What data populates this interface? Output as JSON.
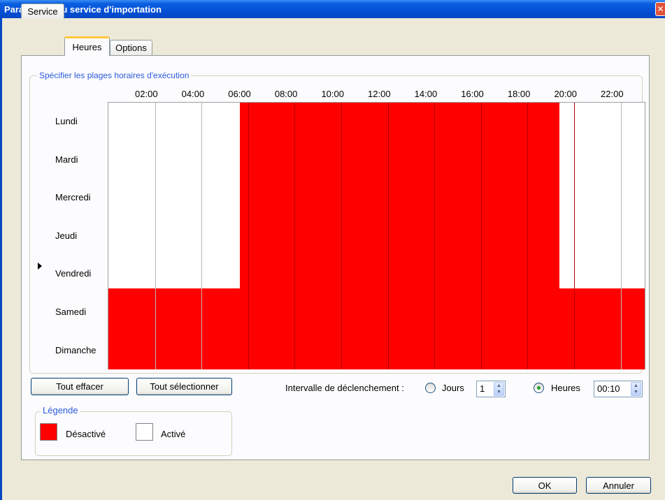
{
  "window": {
    "title": "Paramètres du service d'importation",
    "close_glyph": "✕"
  },
  "tabs": [
    {
      "label": "Service",
      "active": false
    },
    {
      "label": "Heures",
      "active": true
    },
    {
      "label": "Options",
      "active": false
    }
  ],
  "schedule": {
    "group_label": "Spécifier les plages horaires d'exécution",
    "time_labels": [
      "02:00",
      "04:00",
      "06:00",
      "08:00",
      "10:00",
      "12:00",
      "14:00",
      "16:00",
      "18:00",
      "20:00",
      "22:00"
    ],
    "days": [
      "Lundi",
      "Mardi",
      "Mercredi",
      "Jeudi",
      "Vendredi",
      "Samedi",
      "Dimanche"
    ],
    "current_row": "Vendredi",
    "disabled_weekdays_hours": "06:00-20:00",
    "disabled_weekend_hours": "00:00-24:00",
    "colors": {
      "disabled": "#ff0000",
      "enabled": "#ffffff"
    }
  },
  "buttons": {
    "clear_all": "Tout effacer",
    "select_all": "Tout sélectionner",
    "ok": "OK",
    "cancel": "Annuler"
  },
  "interval": {
    "label": "Intervalle de déclenchement :",
    "days_option": "Jours",
    "days_value": "1",
    "hours_option": "Heures",
    "hours_value": "00:10",
    "selected": "Heures"
  },
  "legend": {
    "title": "Légende",
    "disabled_label": "Désactivé",
    "enabled_label": "Activé"
  }
}
